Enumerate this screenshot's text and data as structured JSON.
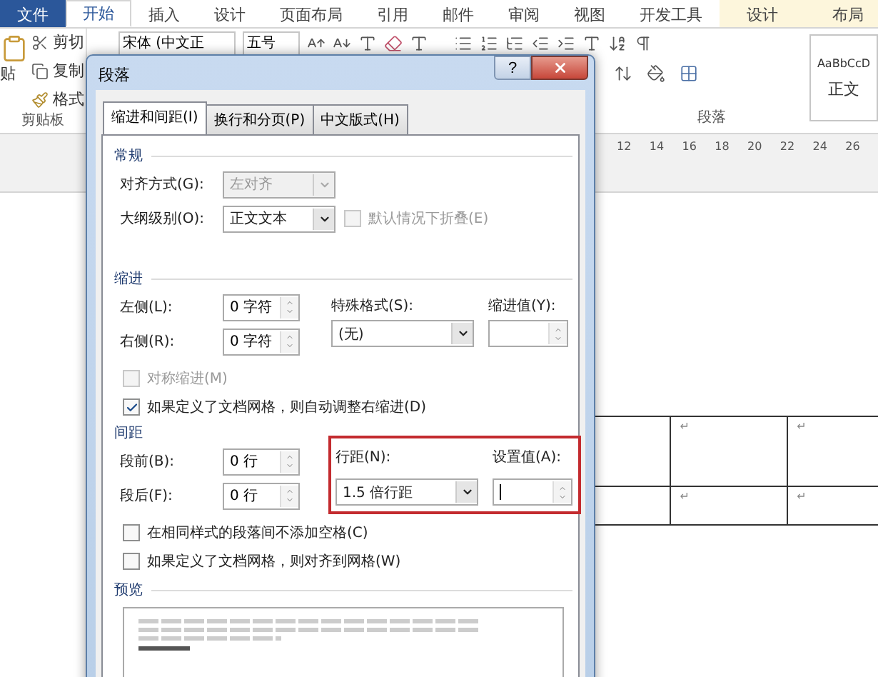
{
  "ribbon_tabs": [
    {
      "label": "文件",
      "kind": "file",
      "selected": false
    },
    {
      "label": "开始",
      "kind": "normal",
      "selected": true
    },
    {
      "label": "插入",
      "kind": "normal",
      "selected": false
    },
    {
      "label": "设计",
      "kind": "normal",
      "selected": false
    },
    {
      "label": "页面布局",
      "kind": "normal",
      "selected": false
    },
    {
      "label": "引用",
      "kind": "normal",
      "selected": false
    },
    {
      "label": "邮件",
      "kind": "normal",
      "selected": false
    },
    {
      "label": "审阅",
      "kind": "normal",
      "selected": false
    },
    {
      "label": "视图",
      "kind": "normal",
      "selected": false
    },
    {
      "label": "开发工具",
      "kind": "normal",
      "selected": false
    },
    {
      "label": "设计",
      "kind": "context",
      "selected": false
    },
    {
      "label": "布局",
      "kind": "context",
      "selected": false
    }
  ],
  "clipboard": {
    "paste": "贴",
    "cut": "剪切",
    "copy": "复制",
    "format": "格式",
    "label": "剪贴板"
  },
  "font": {
    "name": "宋体 (中文正",
    "size": "五号"
  },
  "paragraph": {
    "label": "段落"
  },
  "styles": {
    "sample": "AaBbCcD",
    "name": "正文"
  },
  "ruler": [
    "12",
    "14",
    "16",
    "18",
    "20",
    "22",
    "24",
    "26"
  ],
  "table": {
    "rows": [
      [
        "↵",
        "↵"
      ],
      [
        "↵",
        "↵"
      ]
    ]
  },
  "dialog": {
    "title": "段落",
    "help": "?",
    "tabs": [
      {
        "label": "缩进和间距(I)",
        "selected": true
      },
      {
        "label": "换行和分页(P)",
        "selected": false
      },
      {
        "label": "中文版式(H)",
        "selected": false
      }
    ],
    "general": {
      "heading": "常规",
      "alignment": {
        "label": "对齐方式(G):",
        "value": "左对齐",
        "disabled": true
      },
      "outline": {
        "label": "大纲级别(O):",
        "value": "正文文本",
        "disabled": false
      },
      "collapse": {
        "label": "默认情况下折叠(E)",
        "checked": false,
        "disabled": true
      }
    },
    "indent": {
      "heading": "缩进",
      "left": {
        "label": "左侧(L):",
        "value": "0 字符"
      },
      "right": {
        "label": "右侧(R):",
        "value": "0 字符"
      },
      "special": {
        "label": "特殊格式(S):",
        "value": "(无)"
      },
      "by": {
        "label": "缩进值(Y):"
      },
      "mirror": {
        "label": "对称缩进(M)",
        "checked": false,
        "disabled": true
      },
      "auto_adjust": {
        "label": "如果定义了文档网格，则自动调整右缩进(D)",
        "checked": true,
        "disabled": false
      }
    },
    "spacing": {
      "heading": "间距",
      "before": {
        "label": "段前(B):",
        "value": "0 行"
      },
      "after": {
        "label": "段后(F):",
        "value": "0 行"
      },
      "line_spacing": {
        "label": "行距(N):",
        "value": "1.5 倍行距"
      },
      "at": {
        "label": "设置值(A):",
        "focused": true
      },
      "no_space": {
        "label": "在相同样式的段落间不添加空格(C)",
        "checked": false,
        "disabled": false
      },
      "snap": {
        "label": "如果定义了文档网格，则对齐到网格(W)",
        "checked": false,
        "disabled": false
      }
    },
    "preview": {
      "heading": "预览"
    }
  }
}
